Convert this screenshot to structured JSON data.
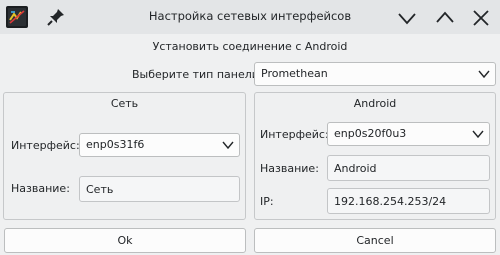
{
  "window": {
    "title": "Настройка сетевых интерфейсов",
    "icons": [
      "app-icon",
      "pin-icon",
      "minimize-icon",
      "maximize-icon",
      "close-icon"
    ]
  },
  "heading": "Установить соединение с Android",
  "panel_type": {
    "label": "Выберите тип панели:",
    "selected": "Promethean"
  },
  "network_group": {
    "title": "Сеть",
    "interface_label": "Интерфейс:",
    "interface_value": "enp0s31f6",
    "name_label": "Название:",
    "name_value": "Сеть"
  },
  "android_group": {
    "title": "Android",
    "interface_label": "Интерфейс:",
    "interface_value": "enp0s20f0u3",
    "name_label": "Название:",
    "name_value": "Android",
    "ip_label": "IP:",
    "ip_value": "192.168.254.253/24"
  },
  "buttons": {
    "ok": "Ok",
    "cancel": "Cancel"
  }
}
